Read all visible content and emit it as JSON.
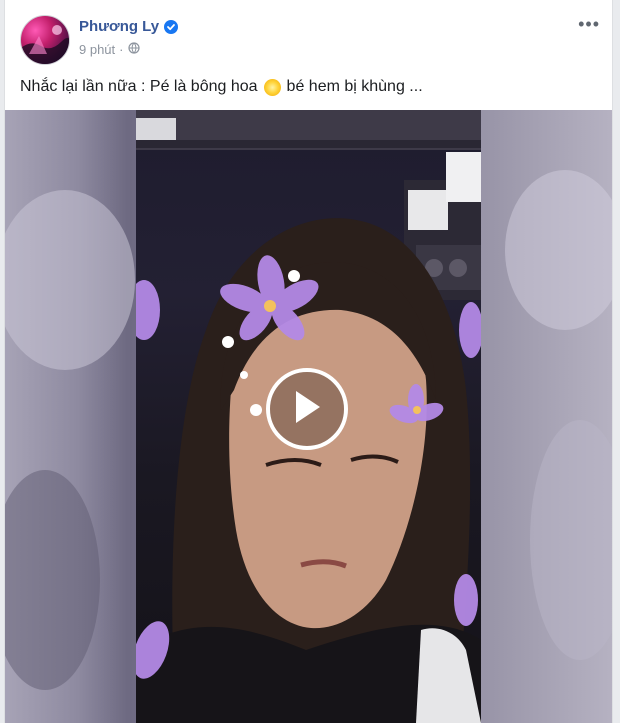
{
  "post": {
    "author": "Phương Ly",
    "time": "9 phút",
    "caption_before": "Nhắc lại lần nữa : Pé là bông hoa",
    "caption_after": "bé hem bị khùng ...",
    "icons": {
      "verified": "verified-badge-icon",
      "audience": "globe-icon",
      "more": "more-options-icon",
      "emoji": "blossom-emoji-icon",
      "play": "play-icon"
    },
    "colors": {
      "author": "#385898",
      "verified": "#1877f2",
      "meta": "#8d949e"
    }
  }
}
